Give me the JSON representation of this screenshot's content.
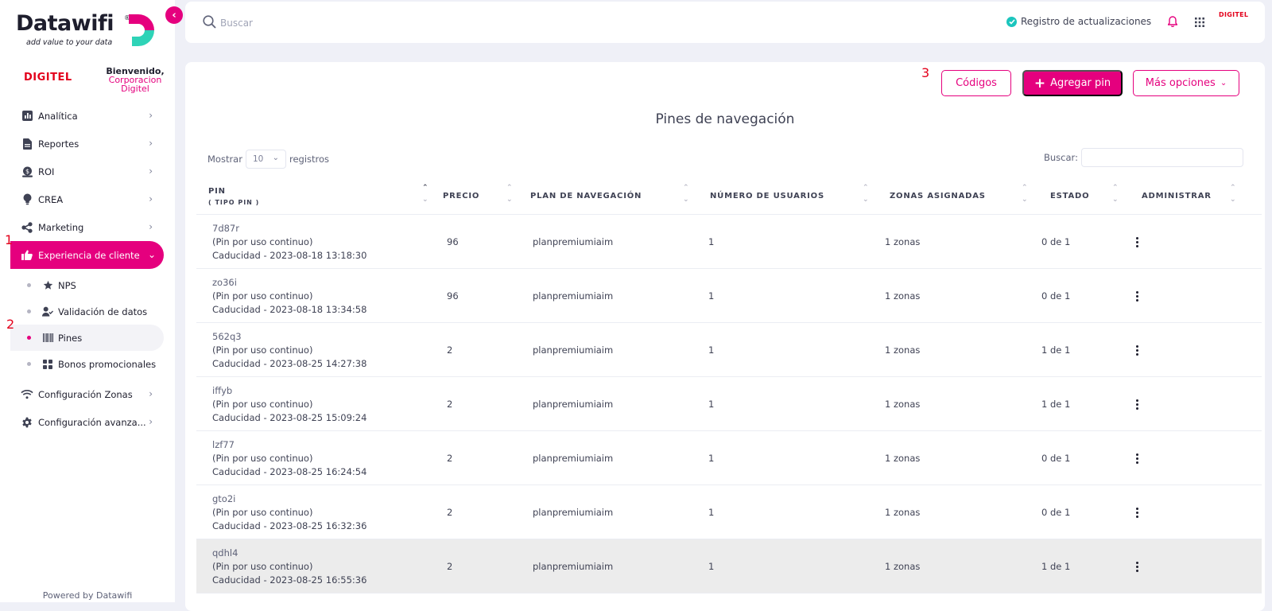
{
  "brand": {
    "name": "Datawifi",
    "registered": "®",
    "tagline": "add value to your data"
  },
  "client": {
    "logo": "DIGITEL",
    "welcome": "Bienvenido,",
    "name": "Corporacion Digitel"
  },
  "sidebar": {
    "items": [
      {
        "label": "Analítica",
        "icon": "chart-icon"
      },
      {
        "label": "Reportes",
        "icon": "document-icon"
      },
      {
        "label": "ROI",
        "icon": "money-icon"
      },
      {
        "label": "CREA",
        "icon": "bulb-icon"
      },
      {
        "label": "Marketing",
        "icon": "share-icon"
      },
      {
        "label": "Experiencia de cliente",
        "icon": "thumbs-up-icon"
      }
    ],
    "subitems": [
      {
        "label": "NPS",
        "icon": "star-icon"
      },
      {
        "label": "Validación de datos",
        "icon": "user-check-icon"
      },
      {
        "label": "Pines",
        "icon": "barcode-icon"
      },
      {
        "label": "Bonos promocionales",
        "icon": "grid-icon"
      }
    ],
    "bottom_items": [
      {
        "label": "Configuración Zonas",
        "icon": "wifi-icon"
      },
      {
        "label": "Configuración avanza...",
        "icon": "gear-icon"
      }
    ],
    "powered_by": "Powered by Datawifi"
  },
  "annotations": {
    "a1": "1",
    "a2": "2",
    "a3": "3"
  },
  "topbar": {
    "search_placeholder": "Buscar",
    "changelog": "Registro de actualizaciones",
    "logo": "DIGITEL"
  },
  "main": {
    "buttons": {
      "codes": "Códigos",
      "add_pin": "Agregar pin",
      "more": "Más opciones"
    },
    "title": "Pines de navegación",
    "length": {
      "prefix": "Mostrar",
      "value": "10",
      "suffix": "registros"
    },
    "filter_label": "Buscar:",
    "table": {
      "headers": {
        "pin": "PIN",
        "pin_sub": "( TIPO PIN )",
        "price": "PRECIO",
        "plan": "PLAN DE NAVEGACIÓN",
        "users": "NÚMERO DE USUARIOS",
        "zones": "ZONAS ASIGNADAS",
        "status": "ESTADO",
        "admin": "ADMINISTRAR"
      },
      "rows": [
        {
          "pin": "7d87r",
          "type": "(Pin por uso continuo)",
          "expiry": "Caducidad - 2023-08-18 13:18:30",
          "price": "96",
          "plan": "planpremiumiaim",
          "users": "1",
          "zones": "1 zonas",
          "status": "0 de 1"
        },
        {
          "pin": "zo36i",
          "type": "(Pin por uso continuo)",
          "expiry": "Caducidad - 2023-08-18 13:34:58",
          "price": "96",
          "plan": "planpremiumiaim",
          "users": "1",
          "zones": "1 zonas",
          "status": "0 de 1"
        },
        {
          "pin": "562q3",
          "type": "(Pin por uso continuo)",
          "expiry": "Caducidad - 2023-08-25 14:27:38",
          "price": "2",
          "plan": "planpremiumiaim",
          "users": "1",
          "zones": "1 zonas",
          "status": "1 de 1"
        },
        {
          "pin": "iffyb",
          "type": "(Pin por uso continuo)",
          "expiry": "Caducidad - 2023-08-25 15:09:24",
          "price": "2",
          "plan": "planpremiumiaim",
          "users": "1",
          "zones": "1 zonas",
          "status": "1 de 1"
        },
        {
          "pin": "lzf77",
          "type": "(Pin por uso continuo)",
          "expiry": "Caducidad - 2023-08-25 16:24:54",
          "price": "2",
          "plan": "planpremiumiaim",
          "users": "1",
          "zones": "1 zonas",
          "status": "0 de 1"
        },
        {
          "pin": "gto2i",
          "type": "(Pin por uso continuo)",
          "expiry": "Caducidad - 2023-08-25 16:32:36",
          "price": "2",
          "plan": "planpremiumiaim",
          "users": "1",
          "zones": "1 zonas",
          "status": "0 de 1"
        },
        {
          "pin": "qdhl4",
          "type": "(Pin por uso continuo)",
          "expiry": "Caducidad - 2023-08-25 16:55:36",
          "price": "2",
          "plan": "planpremiumiaim",
          "users": "1",
          "zones": "1 zonas",
          "status": "1 de 1"
        }
      ]
    }
  },
  "colors": {
    "accent": "#e5007e",
    "brand_teal": "#2ed3b7",
    "annotation": "#e3001b"
  }
}
